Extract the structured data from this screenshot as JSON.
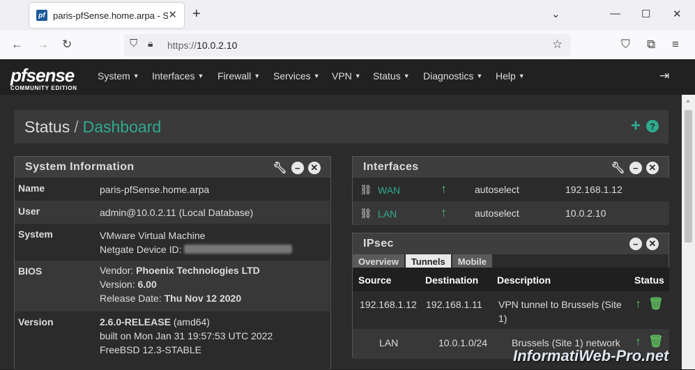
{
  "browser": {
    "tab_title": "paris-pfSense.home.arpa - Status: Dashboard",
    "favicon_text": "pf",
    "url_prefix": "https://",
    "url_host": "10.0.2.10"
  },
  "nav": {
    "logo_text": "pfsense",
    "logo_subtext": "COMMUNITY EDITION",
    "menu": [
      "System",
      "Interfaces",
      "Firewall",
      "Services",
      "VPN",
      "Status",
      "Diagnostics",
      "Help"
    ]
  },
  "breadcrumb": {
    "section": "Status",
    "page": "Dashboard",
    "separator": "/"
  },
  "system_info": {
    "title": "System Information",
    "rows": {
      "name": {
        "label": "Name",
        "value": "paris-pfSense.home.arpa"
      },
      "user": {
        "label": "User",
        "value": "admin@10.0.2.11 (Local Database)"
      },
      "system": {
        "label": "System",
        "line1": "VMware Virtual Machine",
        "line2": "Netgate Device ID:"
      },
      "bios": {
        "label": "BIOS",
        "vendor_label": "Vendor:",
        "vendor": "Phoenix Technologies LTD",
        "version_label": "Version:",
        "version": "6.00",
        "date_label": "Release Date:",
        "date": "Thu Nov 12 2020"
      },
      "version": {
        "label": "Version",
        "release": "2.6.0-RELEASE",
        "arch": "(amd64)",
        "built": "built on Mon Jan 31 19:57:53 UTC 2022",
        "os": "FreeBSD 12.3-STABLE"
      }
    }
  },
  "interfaces": {
    "title": "Interfaces",
    "rows": [
      {
        "name": "WAN",
        "status_icon": "arrow-up-icon",
        "media": "autoselect",
        "ip": "192.168.1.12"
      },
      {
        "name": "LAN",
        "status_icon": "arrow-up-icon",
        "media": "autoselect",
        "ip": "10.0.2.10"
      }
    ]
  },
  "ipsec": {
    "title": "IPsec",
    "tabs": [
      "Overview",
      "Tunnels",
      "Mobile"
    ],
    "active_tab": "Tunnels",
    "columns": [
      "Source",
      "Destination",
      "Description",
      "Status"
    ],
    "rows": [
      {
        "source": "192.168.1.12",
        "destination": "192.168.1.11",
        "description_1": "VPN tunnel to Brussels (Site",
        "description_2": "1)"
      },
      {
        "source": "LAN",
        "destination": "10.0.1.0/24",
        "description_1": "Brussels (Site 1) network",
        "description_2": ""
      }
    ]
  },
  "watermark": "InformatiWeb-Pro.net",
  "colors": {
    "accent": "#2eaa8f",
    "status_up": "#5cb85c",
    "panel_header": "#3e3e3e",
    "background": "#2b2b2b"
  }
}
